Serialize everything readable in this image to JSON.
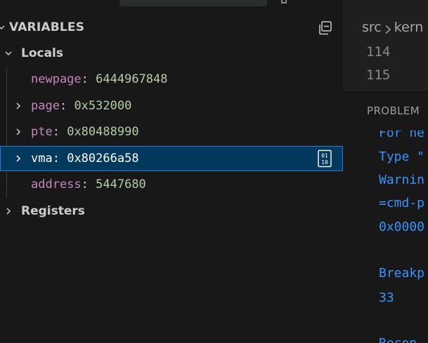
{
  "variables_panel": {
    "title": "VARIABLES",
    "locals_label": "Locals",
    "locals": [
      {
        "name": "newpage",
        "value": "6444967848",
        "expandable": false
      },
      {
        "name": "page",
        "value": "0x532000",
        "expandable": true
      },
      {
        "name": "pte",
        "value": "0x80488990",
        "expandable": true
      },
      {
        "name": "vma",
        "value": "0x80266a58",
        "expandable": true,
        "selected": true
      },
      {
        "name": "address",
        "value": "5447680",
        "expandable": false
      }
    ],
    "registers_label": "Registers",
    "separator": ": "
  },
  "editor": {
    "breadcrumb": [
      "src",
      "kern"
    ],
    "line_numbers": [
      "114",
      "115"
    ]
  },
  "panel": {
    "tab_label": "PROBLEM",
    "output_lines": [
      "For ne",
      "Type \"",
      "Warnin",
      "=cmd-p",
      "0x0000",
      "Breakp",
      "33",
      "Recon"
    ]
  },
  "colors": {
    "var_name": "#c586c0",
    "var_value": "#b5cea8",
    "selection_bg": "#04395e",
    "selection_border": "#2b79d7",
    "output_text": "#3794ff"
  }
}
